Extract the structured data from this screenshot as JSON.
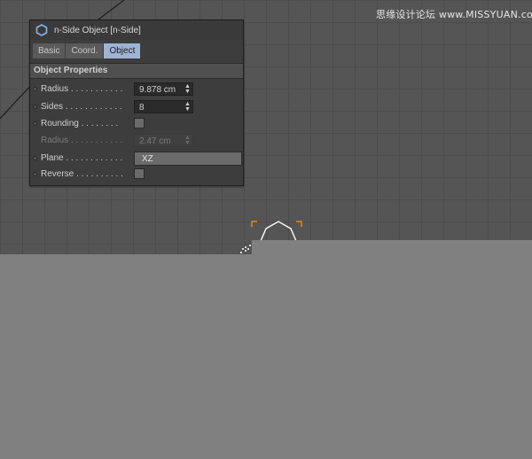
{
  "watermark": "思缘设计论坛 www.MISSYUAN.com",
  "panel": {
    "title": "n-Side Object [n-Side]",
    "tabs": [
      {
        "label": "Basic",
        "active": false
      },
      {
        "label": "Coord.",
        "active": false
      },
      {
        "label": "Object",
        "active": true
      }
    ],
    "section": "Object Properties",
    "rows": [
      {
        "label": "Radius . . . . . . . . . . .",
        "type": "number",
        "value": "9.878 cm",
        "enabled": true
      },
      {
        "label": "Sides . . . . . . . . . . . .",
        "type": "number",
        "value": "8",
        "enabled": true
      },
      {
        "label": "Rounding . . . . . . . .",
        "type": "checkbox",
        "checked": false,
        "enabled": true
      },
      {
        "label": "Radius . . . . . . . . . . .",
        "type": "number",
        "value": "2.47 cm",
        "enabled": false
      },
      {
        "label": "Plane . . . . . . . . . . . .",
        "type": "select",
        "value": "XZ",
        "enabled": true
      },
      {
        "label": "Reverse . . . . . . . . . .",
        "type": "checkbox",
        "checked": false,
        "enabled": true
      }
    ]
  },
  "colors": {
    "viewport_bg": "#555555",
    "grid_line": "#4c4c4c",
    "selection_corner": "#e38a1b",
    "active_tab": "#9fb4d4"
  },
  "icons": {
    "title": "nside-hexagon-icon",
    "spinner": "spinner-arrows-icon",
    "move": "move-handle-icon"
  }
}
